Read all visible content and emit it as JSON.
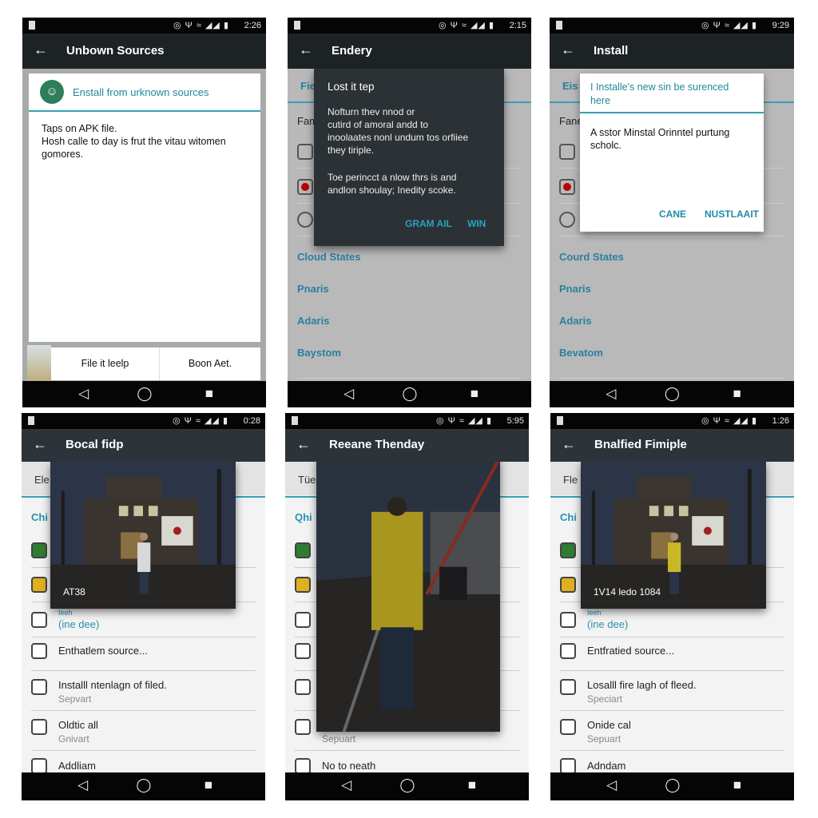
{
  "colors": {
    "accent": "#2a9fb8",
    "appbar": "#1d2225",
    "dialog_dark": "#2b3134",
    "button_text": "#29a3c4",
    "install_icon": "#2e7d5b"
  },
  "phones": [
    {
      "id": "p1",
      "status": {
        "time": "2:26"
      },
      "title": "Unbown Sources",
      "card": {
        "title": "Enstall from urknown sources",
        "lines": [
          "Taps on APK file.",
          "Hosh calle to day is frut the vitau witomen",
          "gomores."
        ]
      },
      "buttons": [
        "File it leelp",
        "Boon Aet."
      ]
    },
    {
      "id": "p2",
      "status": {
        "time": "2:15"
      },
      "title": "Endery",
      "background": {
        "tab": "Fie",
        "section": "Fam",
        "links": [
          "Cloud States",
          "Pnaris",
          "Adaris",
          "Baystom"
        ]
      },
      "dialog": {
        "title": "Lost it tep",
        "para1": [
          "Nofturn thev nnod or",
          "cutird of amoral andd to",
          "inoolaates nonl undum tos orfiiee",
          "they tiriple."
        ],
        "para2": [
          "Toe perincct a nlow thrs is and",
          "andlon shoulay; Inedity scoke."
        ],
        "buttons": [
          "GRAM AIL",
          "WIN"
        ]
      }
    },
    {
      "id": "p3",
      "status": {
        "time": "9:29"
      },
      "title": "Install",
      "background": {
        "tab": "Eis",
        "section": "Fane",
        "links": [
          "Courd States",
          "Pnaris",
          "Adaris",
          "Bevatom"
        ]
      },
      "dialog": {
        "title": [
          "I Installe's new sin be surenced",
          "here"
        ],
        "body": [
          "A sstor Minstal Orinntel purtung",
          "scholc."
        ],
        "buttons": [
          "CANE",
          "NUSTLAAIT"
        ]
      }
    },
    {
      "id": "p4",
      "status": {
        "time": "0:28"
      },
      "title": "Bocal fidp",
      "tab": "Ele",
      "section": "Chi",
      "caption": "AT38",
      "items": {
        "small": "Ieeh",
        "link": "(ine dee)",
        "source": "Enthatlem source...",
        "install": {
          "title": "Installl ntenlagn of filed.",
          "sub": "Sepvart"
        },
        "other": {
          "title": "Oldtic all",
          "sub": "Gnivart"
        },
        "last": "Addliam"
      }
    },
    {
      "id": "p5",
      "status": {
        "time": "5:95"
      },
      "title": "Reeane Thenday",
      "tab": "Tüe",
      "section": "Qhi",
      "caption": "",
      "items": {
        "other": {
          "title": "",
          "sub": "Sepuart"
        },
        "last": "No to neath"
      }
    },
    {
      "id": "p6",
      "status": {
        "time": "1:26"
      },
      "title": "Bnalfied Fimiple",
      "tab": "Fle",
      "section": "Chi",
      "caption": "1V14 ledo 1084",
      "items": {
        "small": "Ieeh",
        "link": "(ine dee)",
        "source": "Entfratied source...",
        "install": {
          "title": "Losalll fire lagh of fleed.",
          "sub": "Speciart"
        },
        "other": {
          "title": "Onide cal",
          "sub": "Sepuart"
        },
        "last": "Adndam"
      }
    }
  ],
  "icons": {
    "back": "arrow-left-icon",
    "nav": [
      "back-triangle-icon",
      "home-circle-icon",
      "recents-square-icon"
    ],
    "status": [
      "alarm-icon",
      "antenna-icon",
      "wifi-icon",
      "signal-icon",
      "battery-icon"
    ]
  }
}
